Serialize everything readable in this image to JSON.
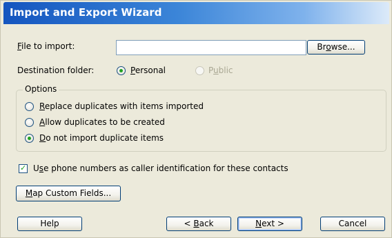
{
  "dialog": {
    "title": "Import and Export Wizard"
  },
  "file_to_import": {
    "label_pre": "",
    "label_key": "F",
    "label_post": "ile to import:",
    "value": "",
    "browse_pre": "Br",
    "browse_key": "o",
    "browse_post": "wse..."
  },
  "destination": {
    "label": "Destination folder:",
    "personal_pre": "",
    "personal_key": "P",
    "personal_post": "ersonal",
    "personal_selected": true,
    "public_pre": "P",
    "public_key": "u",
    "public_post": "blic",
    "public_enabled": false
  },
  "options": {
    "legend": "Options",
    "items": [
      {
        "pre": "",
        "key": "R",
        "post": "eplace duplicates with items imported",
        "selected": false
      },
      {
        "pre": "",
        "key": "A",
        "post": "llow duplicates to be created",
        "selected": false
      },
      {
        "pre": "",
        "key": "D",
        "post": "o not import duplicate items",
        "selected": true
      }
    ]
  },
  "caller_id": {
    "pre": "U",
    "key": "s",
    "post": "e phone numbers as caller identification for these contacts",
    "checked": true
  },
  "map_fields": {
    "pre": "",
    "key": "M",
    "post": "ap Custom Fields..."
  },
  "footer": {
    "help": "Help",
    "back_pre": "< ",
    "back_key": "B",
    "back_post": "ack",
    "next_pre": "",
    "next_key": "N",
    "next_post": "ext >",
    "cancel": "Cancel"
  }
}
